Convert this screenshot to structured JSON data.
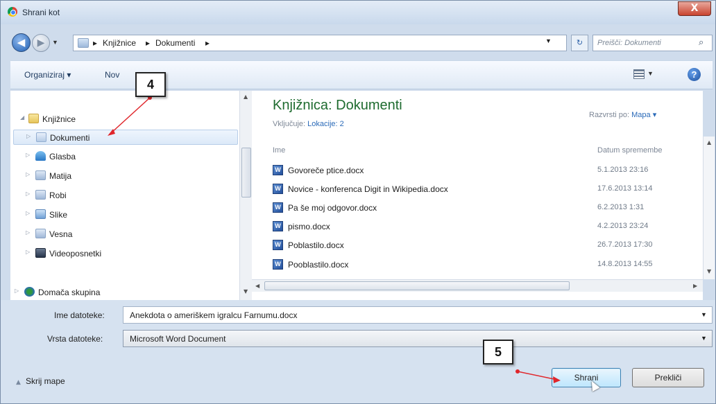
{
  "window": {
    "title": "Shrani kot",
    "close_label": "X"
  },
  "address": {
    "crumbs": [
      "Knjižnice",
      "Dokumenti"
    ],
    "search_placeholder": "Preišči: Dokumenti"
  },
  "toolbar": {
    "organize_label": "Organiziraj ▾",
    "new_folder_label": "Nov",
    "help_label": "?"
  },
  "nav_tree": {
    "libraries_label": "Knjižnice",
    "items": [
      {
        "label": "Dokumenti"
      },
      {
        "label": "Glasba"
      },
      {
        "label": "Matija"
      },
      {
        "label": "Robi"
      },
      {
        "label": "Slike"
      },
      {
        "label": "Vesna"
      },
      {
        "label": "Videoposnetki"
      }
    ],
    "homegroup_label": "Domača skupina"
  },
  "library": {
    "title": "Knjižnica: Dokumenti",
    "includes_label": "Vključuje:",
    "includes_link": "Lokacije: 2",
    "sort_label": "Razvrsti po:",
    "sort_value": "Mapa ▾"
  },
  "columns": {
    "name": "Ime",
    "date": "Datum spremembe"
  },
  "files": [
    {
      "name": "Govoreče ptice.docx",
      "date": "5.1.2013 23:16"
    },
    {
      "name": "Novice - konferenca Digit in Wikipedia.docx",
      "date": "17.6.2013 13:14"
    },
    {
      "name": "Pa še moj odgovor.docx",
      "date": "6.2.2013 1:31"
    },
    {
      "name": "pismo.docx",
      "date": "4.2.2013 23:24"
    },
    {
      "name": "Poblastilo.docx",
      "date": "26.7.2013 17:30"
    },
    {
      "name": "Pooblastilo.docx",
      "date": "14.8.2013 14:55"
    }
  ],
  "form": {
    "filename_label": "Ime datoteke:",
    "filename_value": "Anekdota o ameriškem igralcu Farnumu.docx",
    "filetype_label": "Vrsta datoteke:",
    "filetype_value": "Microsoft Word Document"
  },
  "footer": {
    "hide_folders_label": "Skrij mape",
    "save_label": "Shrani",
    "cancel_label": "Prekliči"
  },
  "callouts": {
    "step4": "4",
    "step5": "5"
  },
  "colors": {
    "accent": "#1e6b2f",
    "link": "#2a6ab8",
    "callout_arrow": "#e0262b"
  }
}
